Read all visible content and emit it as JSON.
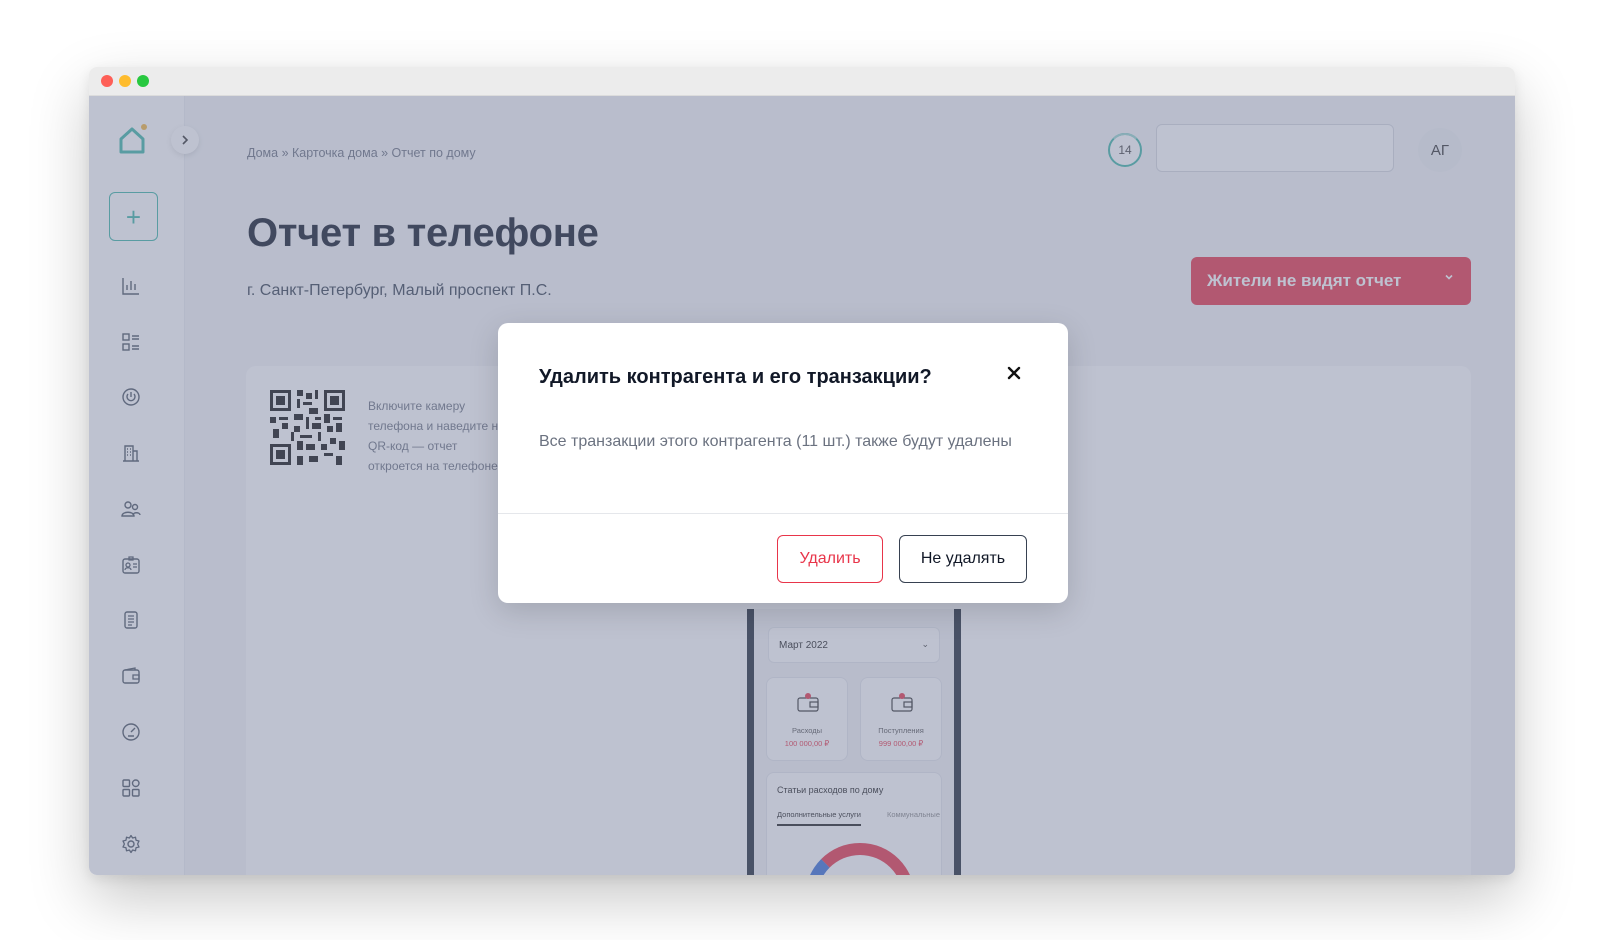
{
  "header": {
    "breadcrumb": "Дома » Карточка дома » Отчет по дому",
    "timer_value": "14",
    "search_placeholder": "",
    "avatar_initials": "АГ"
  },
  "sidebar": {
    "add_label": "+",
    "items": [
      {
        "icon": "chart-icon"
      },
      {
        "icon": "list-icon"
      },
      {
        "icon": "power-icon"
      },
      {
        "icon": "building-icon"
      },
      {
        "icon": "users-icon"
      },
      {
        "icon": "id-card-icon"
      },
      {
        "icon": "document-icon"
      },
      {
        "icon": "wallet-icon"
      },
      {
        "icon": "gauge-icon"
      },
      {
        "icon": "apps-icon"
      },
      {
        "icon": "gear-icon"
      }
    ]
  },
  "page": {
    "title": "Отчет в телефоне",
    "address": "г. Санкт-Петербург, Малый проспект П.С.",
    "status_button": "Жители не видят отчет"
  },
  "report_card": {
    "qr_hint": "Включите камеру телефона и наведите на QR-код — отчет откроется на телефоне"
  },
  "phone": {
    "month": "Март 2022",
    "expenses_label": "Расходы",
    "expenses_value": "100 000,00 ₽",
    "income_label": "Поступления",
    "income_value": "999 000,00 ₽",
    "stats_title": "Статьи расходов по дому",
    "tab_additional": "Дополнительные услуги",
    "tab_utilities": "Коммунальные"
  },
  "modal": {
    "title": "Удалить контрагента и его транзакции?",
    "body": "Все транзакции этого контрагента (11 шт.) также будут удалены",
    "delete_label": "Удалить",
    "cancel_label": "Не удалять"
  },
  "colors": {
    "accent": "#3fb6a8",
    "danger": "#e8354a"
  }
}
